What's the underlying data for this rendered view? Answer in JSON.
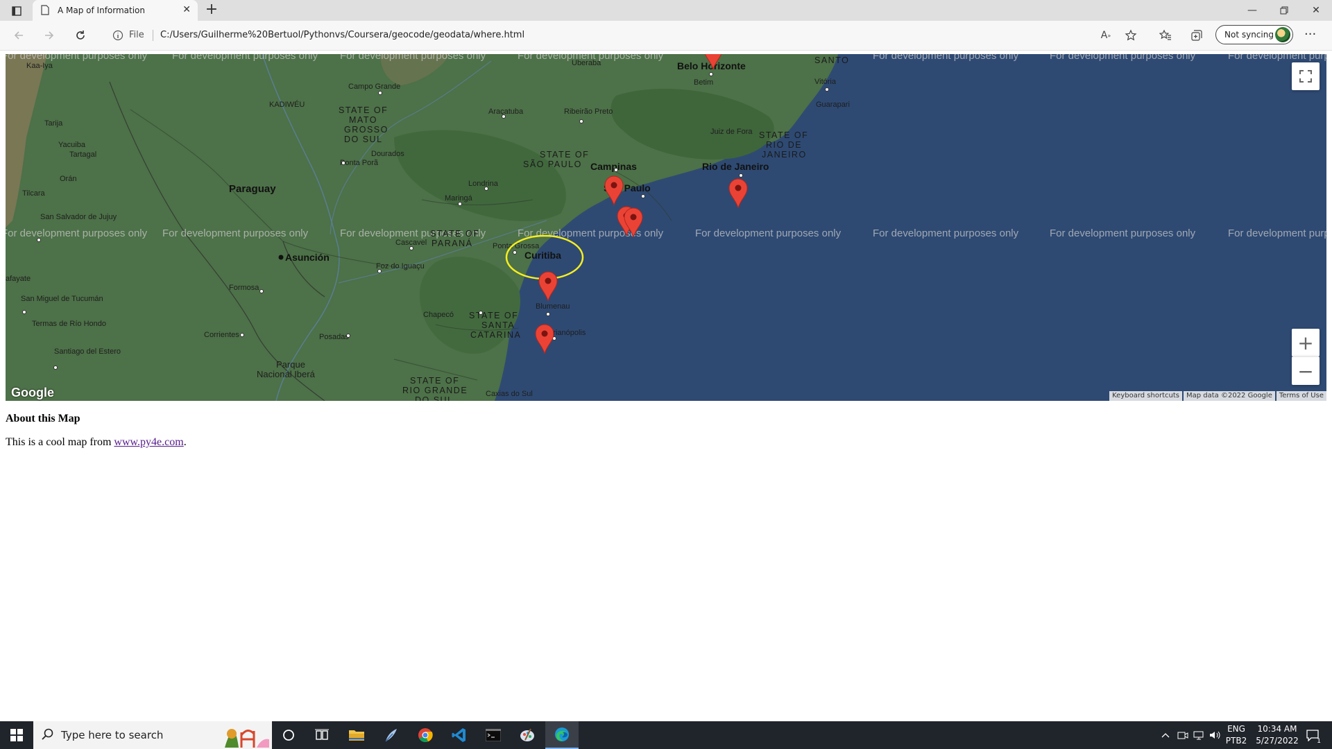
{
  "browser": {
    "tab_title": "A Map of Information",
    "new_tab": "+",
    "file_label": "File",
    "url": "C:/Users/Guilherme%20Bertuol/Pythonvs/Coursera/geocode/geodata/where.html",
    "sync_label": "Not syncing",
    "more_label": "···"
  },
  "map": {
    "watermark": "For development purposes only",
    "cities": {
      "belo_horizonte": "Belo Horizonte",
      "betim": "Betim",
      "uberaba": "Uberaba",
      "vitoria": "Vitória",
      "guarapari": "Guarapari",
      "juiz_de_fora": "Juiz de Fora",
      "rio": "Rio de Janeiro",
      "campinas": "Campinas",
      "sao_paulo": "São Paulo",
      "ribeirao_preto": "Ribeirão Preto",
      "araraquara": "Araçatuba",
      "campo_grande": "Campo Grande",
      "dourados": "Dourados",
      "ponta_pora": "Ponta Porã",
      "londrina": "Londrina",
      "maringa": "Maringá",
      "cascavel": "Cascavel",
      "ponta_grossa": "Ponta Grossa",
      "curitiba": "Curitiba",
      "foz": "Foz do Iguaçu",
      "chapeco": "Chapecó",
      "blumenau": "Blumenau",
      "florianopolis": "Florianópolis",
      "caxias": "Caxias do Sul",
      "asuncion": "Asunción",
      "formosa": "Formosa",
      "corrientes": "Corrientes",
      "posadas": "Posadas",
      "tarija": "Tarija",
      "yacuiba": "Yacuiba",
      "tartagal": "Tartagal",
      "oran": "Orán",
      "tilcara": "Tilcara",
      "san_salvador": "San Salvador de Jujuy",
      "cafayate": "afayate",
      "san_miguel": "San Miguel de Tucumán",
      "termas": "Termas de Río Hondo",
      "santiago": "Santiago del Estero",
      "kaa_iya": "Kaa-Iya",
      "kadiweu": "KADIWÉU",
      "santo": "SANTO"
    },
    "regions": {
      "paraguay": "Paraguay",
      "ms": [
        "STATE OF",
        "MATO",
        "GROSSO",
        "DO SUL"
      ],
      "sp": [
        "STATE OF",
        "SÃO PAULO"
      ],
      "rj": [
        "STATE OF",
        "RIO DE",
        "JANEIRO"
      ],
      "pr": [
        "STATE OF",
        "PARANÁ"
      ],
      "sc": [
        "STATE OF",
        "SANTA",
        "CATARINA"
      ],
      "rs": [
        "STATE OF",
        "RIO GRANDE",
        "DO SUL"
      ],
      "iberá": [
        "Parque",
        "Nacional Iberá"
      ]
    },
    "markers": [
      {
        "name": "Belo Horizonte"
      },
      {
        "name": "Campinas"
      },
      {
        "name": "Rio de Janeiro"
      },
      {
        "name": "São Paulo A"
      },
      {
        "name": "São Paulo B"
      },
      {
        "name": "Curitiba"
      },
      {
        "name": "Blumenau"
      },
      {
        "name": "Caxias do Sul"
      }
    ],
    "highlight_color": "#f5ee1f",
    "marker_color": "#ea4335",
    "ocean_color": "#2e4a73",
    "land_color": "#4d7148",
    "google_logo": "Google",
    "attribution": {
      "shortcuts": "Keyboard shortcuts",
      "data": "Map data ©2022 Google",
      "terms": "Terms of Use"
    },
    "zoom_in": "+",
    "zoom_out": "−"
  },
  "page": {
    "about_title": "About this Map",
    "about_prefix": "This is a cool map from ",
    "about_link": "www.py4e.com",
    "about_suffix": "."
  },
  "taskbar": {
    "search_placeholder": "Type here to search",
    "lang": "ENG",
    "layout": "PTB2",
    "time": "10:34 AM",
    "date": "5/27/2022",
    "notification_count": "1"
  }
}
